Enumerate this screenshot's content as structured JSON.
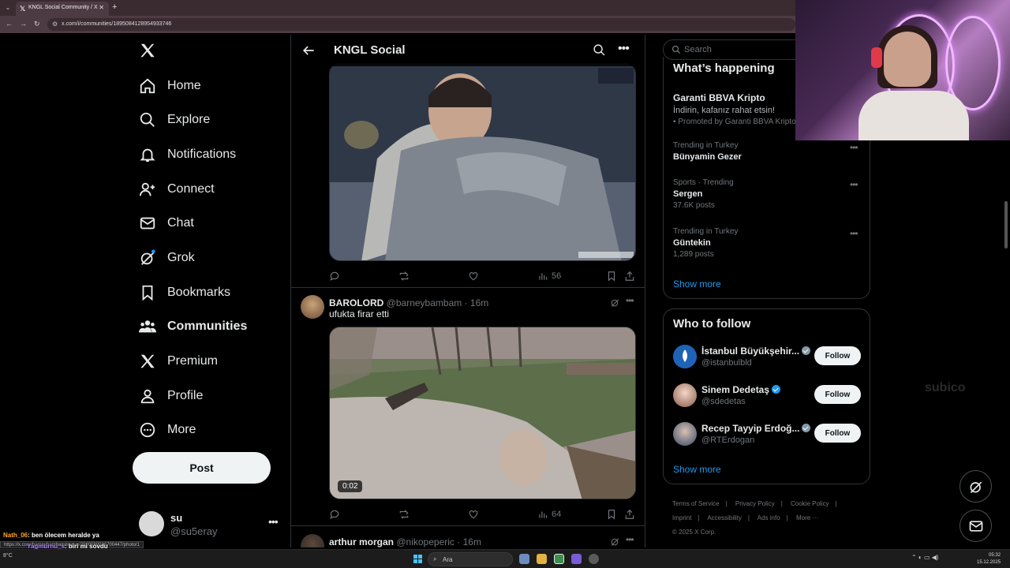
{
  "browser": {
    "tab_title": "KNGL Social Community / X",
    "url": "x.com/i/communities/1895084128954933746"
  },
  "nav": {
    "items": [
      {
        "label": "Home",
        "icon": "home-icon"
      },
      {
        "label": "Explore",
        "icon": "search-icon"
      },
      {
        "label": "Notifications",
        "icon": "bell-icon"
      },
      {
        "label": "Connect",
        "icon": "person-plus-icon"
      },
      {
        "label": "Chat",
        "icon": "envelope-icon"
      },
      {
        "label": "Grok",
        "icon": "grok-icon"
      },
      {
        "label": "Bookmarks",
        "icon": "bookmark-icon"
      },
      {
        "label": "Communities",
        "icon": "people-icon"
      },
      {
        "label": "Premium",
        "icon": "x-icon"
      },
      {
        "label": "Profile",
        "icon": "person-icon"
      },
      {
        "label": "More",
        "icon": "more-circle-icon"
      }
    ],
    "post_label": "Post",
    "user": {
      "name": "su",
      "handle": "@su5eray"
    }
  },
  "header": {
    "title": "KNGL Social"
  },
  "tweets": [
    {
      "views": "56"
    },
    {
      "name": "BAROLORD",
      "handle": "@barneybambam",
      "time": "16m",
      "text": "ufukta firar etti",
      "duration": "0:02",
      "views": "64"
    },
    {
      "name": "arthur morgan",
      "handle": "@nikopeperic",
      "time": "16m"
    }
  ],
  "right": {
    "search_placeholder": "Search",
    "happening": {
      "title": "What’s happening",
      "promo": {
        "name": "Garanti BBVA Kripto",
        "desc": "İndirin, kafanız rahat etsin!",
        "promoted": "Promoted by Garanti BBVA Kripto"
      },
      "trends": [
        {
          "context": "Trending in Turkey",
          "name": "Bünyamin Gezer",
          "posts": ""
        },
        {
          "context": "Sports · Trending",
          "name": "Sergen",
          "posts": "37.6K posts"
        },
        {
          "context": "Trending in Turkey",
          "name": "Güntekin",
          "posts": "1,289 posts"
        }
      ],
      "show_more": "Show more"
    },
    "who_to_follow": {
      "title": "Who to follow",
      "accounts": [
        {
          "name": "İstanbul Büyükşehir...",
          "handle": "@istanbulbld",
          "button": "Follow"
        },
        {
          "name": "Sinem Dedetaş",
          "handle": "@sdedetas",
          "button": "Follow"
        },
        {
          "name": "Recep Tayyip Erdoğ...",
          "handle": "@RTErdogan",
          "button": "Follow"
        }
      ],
      "show_more": "Show more"
    },
    "footer": {
      "links": [
        "Terms of Service",
        "Privacy Policy",
        "Cookie Policy",
        "Imprint",
        "Accessibility",
        "Ads info",
        "More ···"
      ],
      "copyright": "© 2025 X Corp."
    }
  },
  "overlay": {
    "chat": [
      {
        "user": "Nath_06",
        "message": ": ben ölecem heralde ya"
      },
      {
        "user": "Yagmurnu_s",
        "message": ": biri mi sovdu"
      }
    ],
    "status_url": "https://x.com/barneybambam/status/2000080036700447/photo/1",
    "side_text": "subico"
  },
  "taskbar": {
    "weather": "8°C",
    "search_label": "Ara",
    "time": "05:32",
    "date": "15.12.2025"
  }
}
